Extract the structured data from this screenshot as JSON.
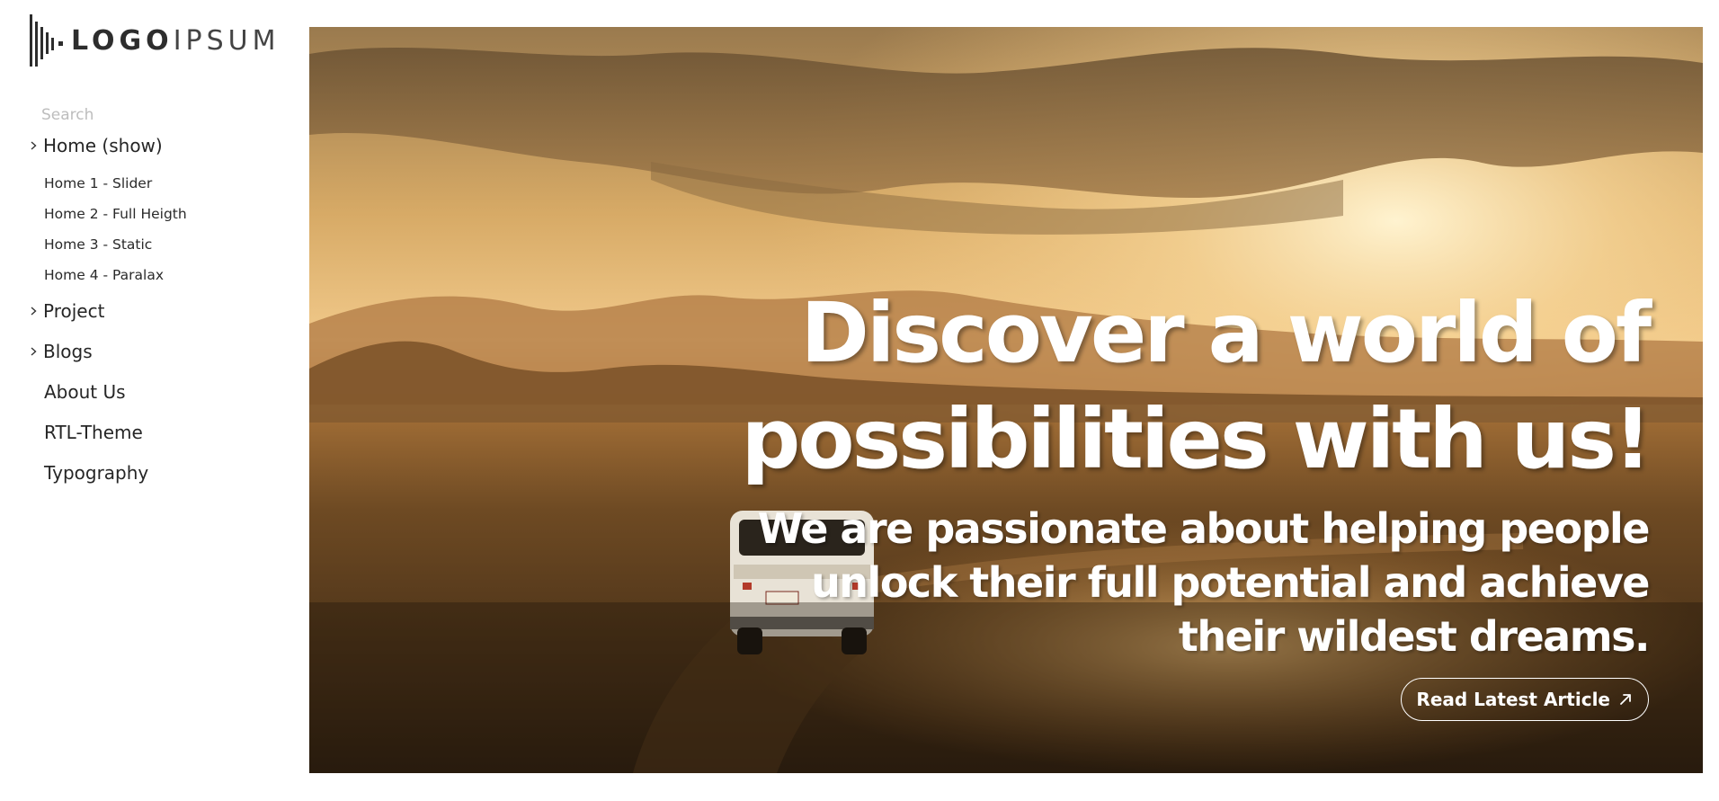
{
  "logo": {
    "strong": "LOGO",
    "light": "IPSUM"
  },
  "search": {
    "placeholder": "Search"
  },
  "menu": {
    "home": {
      "label": "Home (show)",
      "icon": "chevron-right-icon"
    },
    "home_sub": [
      {
        "label": "Home 1 - Slider"
      },
      {
        "label": "Home 2 - Full Heigth"
      },
      {
        "label": "Home 3 - Static"
      },
      {
        "label": "Home 4 - Paralax"
      }
    ],
    "project": {
      "label": "Project",
      "icon": "chevron-right-icon"
    },
    "blogs": {
      "label": "Blogs",
      "icon": "chevron-right-icon"
    },
    "about": {
      "label": "About Us"
    },
    "rtl": {
      "label": "RTL-Theme"
    },
    "typography": {
      "label": "Typography"
    }
  },
  "hero": {
    "title_line1": "Discover a world of",
    "title_line2": "possibilities with us!",
    "subtitle": "We are passionate about helping people unlock their full potential and achieve their wildest dreams.",
    "cta_label": "Read Latest Article",
    "cta_icon": "arrow-up-right-icon"
  },
  "colors": {
    "sky_top": "#8a6a3e",
    "sky_glow": "#f6d79a",
    "ground": "#3b2814",
    "text_light": "#ffffff"
  }
}
